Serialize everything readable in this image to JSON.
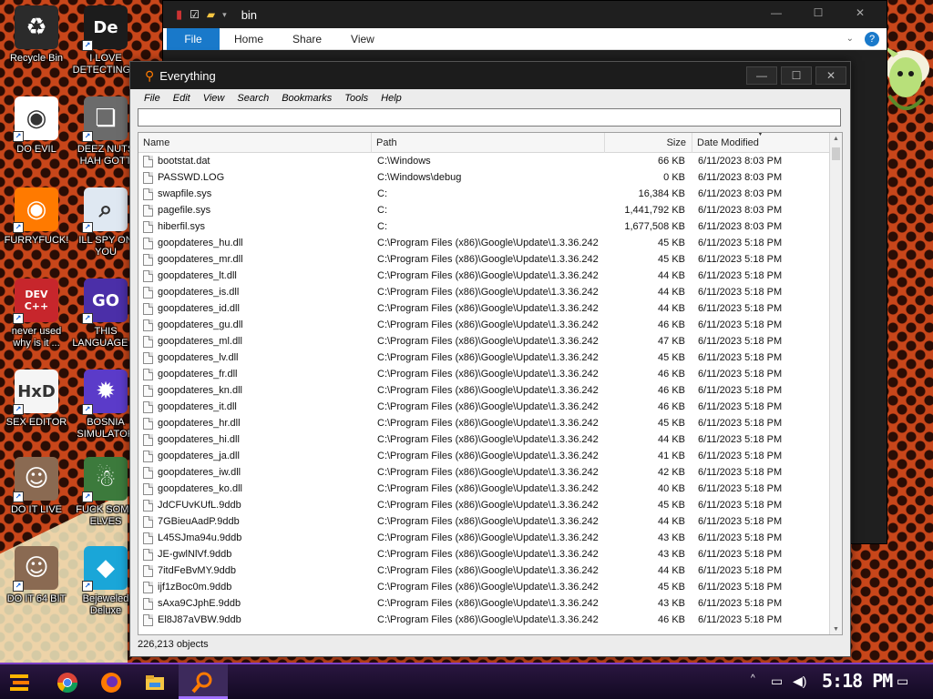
{
  "desktop": {
    "icons": [
      {
        "label": "Recycle Bin",
        "color": "#2b2b2b",
        "glyph": "♻"
      },
      {
        "label": "I LOVE DETECTING...",
        "color": "#1c1c1c",
        "glyph": "De"
      },
      {
        "label": "DO EVIL",
        "color": "#ffffff",
        "glyph": "◉"
      },
      {
        "label": "DEEZ NUTS HAH GOTT",
        "color": "#6b6b6b",
        "glyph": "❏"
      },
      {
        "label": "FURRYFUCK!",
        "color": "#ff7a00",
        "glyph": "◉"
      },
      {
        "label": "ILL SPY ON YOU",
        "color": "#dfe8f2",
        "glyph": "⌕"
      },
      {
        "label": "never used why is it ...",
        "color": "#c7262c",
        "glyph": "DEV C++"
      },
      {
        "label": "THIS LANGUAGE ...",
        "color": "#4b2fa8",
        "glyph": "GO"
      },
      {
        "label": "SEX EDITOR",
        "color": "#f5f5f5",
        "glyph": "HxD"
      },
      {
        "label": "BOSNIA SIMULATOR",
        "color": "#5b3bc9",
        "glyph": "✹"
      },
      {
        "label": "DO IT LIVE",
        "color": "#8a6a52",
        "glyph": "☺"
      },
      {
        "label": "FUCK SOME ELVES",
        "color": "#3c7a3c",
        "glyph": "☃"
      },
      {
        "label": "DO IT 64 BIT",
        "color": "#8a6a52",
        "glyph": "☺"
      },
      {
        "label": "Bejeweled Deluxe",
        "color": "#1aa6d8",
        "glyph": "◆"
      }
    ]
  },
  "explorer": {
    "title": "bin",
    "ribbon": {
      "file": "File",
      "tabs": [
        "Home",
        "Share",
        "View"
      ]
    }
  },
  "everything": {
    "title": "Everything",
    "menu": [
      "File",
      "Edit",
      "View",
      "Search",
      "Bookmarks",
      "Tools",
      "Help"
    ],
    "search_value": "",
    "columns": {
      "name": "Name",
      "path": "Path",
      "size": "Size",
      "date": "Date Modified"
    },
    "rows": [
      {
        "name": "bootstat.dat",
        "path": "C:\\Windows",
        "size": "66 KB",
        "date": "6/11/2023 8:03 PM"
      },
      {
        "name": "PASSWD.LOG",
        "path": "C:\\Windows\\debug",
        "size": "0 KB",
        "date": "6/11/2023 8:03 PM"
      },
      {
        "name": "swapfile.sys",
        "path": "C:",
        "size": "16,384 KB",
        "date": "6/11/2023 8:03 PM"
      },
      {
        "name": "pagefile.sys",
        "path": "C:",
        "size": "1,441,792 KB",
        "date": "6/11/2023 8:03 PM"
      },
      {
        "name": "hiberfil.sys",
        "path": "C:",
        "size": "1,677,508 KB",
        "date": "6/11/2023 8:03 PM"
      },
      {
        "name": "goopdateres_hu.dll",
        "path": "C:\\Program Files (x86)\\Google\\Update\\1.3.36.242",
        "size": "45 KB",
        "date": "6/11/2023 5:18 PM"
      },
      {
        "name": "goopdateres_mr.dll",
        "path": "C:\\Program Files (x86)\\Google\\Update\\1.3.36.242",
        "size": "45 KB",
        "date": "6/11/2023 5:18 PM"
      },
      {
        "name": "goopdateres_lt.dll",
        "path": "C:\\Program Files (x86)\\Google\\Update\\1.3.36.242",
        "size": "44 KB",
        "date": "6/11/2023 5:18 PM"
      },
      {
        "name": "goopdateres_is.dll",
        "path": "C:\\Program Files (x86)\\Google\\Update\\1.3.36.242",
        "size": "44 KB",
        "date": "6/11/2023 5:18 PM"
      },
      {
        "name": "goopdateres_id.dll",
        "path": "C:\\Program Files (x86)\\Google\\Update\\1.3.36.242",
        "size": "44 KB",
        "date": "6/11/2023 5:18 PM"
      },
      {
        "name": "goopdateres_gu.dll",
        "path": "C:\\Program Files (x86)\\Google\\Update\\1.3.36.242",
        "size": "46 KB",
        "date": "6/11/2023 5:18 PM"
      },
      {
        "name": "goopdateres_ml.dll",
        "path": "C:\\Program Files (x86)\\Google\\Update\\1.3.36.242",
        "size": "47 KB",
        "date": "6/11/2023 5:18 PM"
      },
      {
        "name": "goopdateres_lv.dll",
        "path": "C:\\Program Files (x86)\\Google\\Update\\1.3.36.242",
        "size": "45 KB",
        "date": "6/11/2023 5:18 PM"
      },
      {
        "name": "goopdateres_fr.dll",
        "path": "C:\\Program Files (x86)\\Google\\Update\\1.3.36.242",
        "size": "46 KB",
        "date": "6/11/2023 5:18 PM"
      },
      {
        "name": "goopdateres_kn.dll",
        "path": "C:\\Program Files (x86)\\Google\\Update\\1.3.36.242",
        "size": "46 KB",
        "date": "6/11/2023 5:18 PM"
      },
      {
        "name": "goopdateres_it.dll",
        "path": "C:\\Program Files (x86)\\Google\\Update\\1.3.36.242",
        "size": "46 KB",
        "date": "6/11/2023 5:18 PM"
      },
      {
        "name": "goopdateres_hr.dll",
        "path": "C:\\Program Files (x86)\\Google\\Update\\1.3.36.242",
        "size": "45 KB",
        "date": "6/11/2023 5:18 PM"
      },
      {
        "name": "goopdateres_hi.dll",
        "path": "C:\\Program Files (x86)\\Google\\Update\\1.3.36.242",
        "size": "44 KB",
        "date": "6/11/2023 5:18 PM"
      },
      {
        "name": "goopdateres_ja.dll",
        "path": "C:\\Program Files (x86)\\Google\\Update\\1.3.36.242",
        "size": "41 KB",
        "date": "6/11/2023 5:18 PM"
      },
      {
        "name": "goopdateres_iw.dll",
        "path": "C:\\Program Files (x86)\\Google\\Update\\1.3.36.242",
        "size": "42 KB",
        "date": "6/11/2023 5:18 PM"
      },
      {
        "name": "goopdateres_ko.dll",
        "path": "C:\\Program Files (x86)\\Google\\Update\\1.3.36.242",
        "size": "40 KB",
        "date": "6/11/2023 5:18 PM"
      },
      {
        "name": "JdCFUvKUfL.9ddb",
        "path": "C:\\Program Files (x86)\\Google\\Update\\1.3.36.242",
        "size": "45 KB",
        "date": "6/11/2023 5:18 PM"
      },
      {
        "name": "7GBieuAadP.9ddb",
        "path": "C:\\Program Files (x86)\\Google\\Update\\1.3.36.242",
        "size": "44 KB",
        "date": "6/11/2023 5:18 PM"
      },
      {
        "name": "L45SJma94u.9ddb",
        "path": "C:\\Program Files (x86)\\Google\\Update\\1.3.36.242",
        "size": "43 KB",
        "date": "6/11/2023 5:18 PM"
      },
      {
        "name": "JE-gwlNlVf.9ddb",
        "path": "C:\\Program Files (x86)\\Google\\Update\\1.3.36.242",
        "size": "43 KB",
        "date": "6/11/2023 5:18 PM"
      },
      {
        "name": "7itdFeBvMY.9ddb",
        "path": "C:\\Program Files (x86)\\Google\\Update\\1.3.36.242",
        "size": "44 KB",
        "date": "6/11/2023 5:18 PM"
      },
      {
        "name": "ijf1zBoc0m.9ddb",
        "path": "C:\\Program Files (x86)\\Google\\Update\\1.3.36.242",
        "size": "45 KB",
        "date": "6/11/2023 5:18 PM"
      },
      {
        "name": "sAxa9CJphE.9ddb",
        "path": "C:\\Program Files (x86)\\Google\\Update\\1.3.36.242",
        "size": "43 KB",
        "date": "6/11/2023 5:18 PM"
      },
      {
        "name": "El8J87aVBW.9ddb",
        "path": "C:\\Program Files (x86)\\Google\\Update\\1.3.36.242",
        "size": "46 KB",
        "date": "6/11/2023 5:18 PM"
      }
    ],
    "status": "226,213 objects"
  },
  "taskbar": {
    "clock": "5:18 PM",
    "apps": [
      {
        "name": "start-menu-icon",
        "color": "#ffb400"
      },
      {
        "name": "chrome-icon",
        "color": "#1a73e8"
      },
      {
        "name": "firefox-icon",
        "color": "#ff7a00"
      },
      {
        "name": "file-explorer-icon",
        "color": "#f5c542"
      },
      {
        "name": "everything-search-icon",
        "color": "#ff6a00"
      }
    ]
  }
}
